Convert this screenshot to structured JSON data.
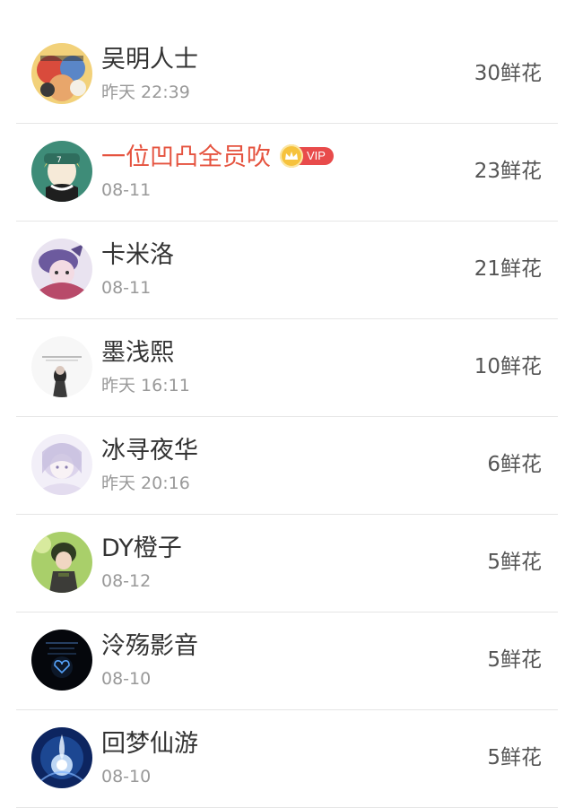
{
  "rows": [
    {
      "name": "吴明人士",
      "time": "昨天 22:39",
      "flowers": "30鲜花",
      "vip": false
    },
    {
      "name": "一位凹凸全员吹",
      "time": "08-11",
      "flowers": "23鲜花",
      "vip": true,
      "vip_label": "VIP"
    },
    {
      "name": "卡米洛",
      "time": "08-11",
      "flowers": "21鲜花",
      "vip": false
    },
    {
      "name": "墨浅熙",
      "time": "昨天 16:11",
      "flowers": "10鲜花",
      "vip": false
    },
    {
      "name": "冰寻夜华",
      "time": "昨天 20:16",
      "flowers": "6鲜花",
      "vip": false
    },
    {
      "name": "DY橙子",
      "time": "08-12",
      "flowers": "5鲜花",
      "vip": false
    },
    {
      "name": "泠殇影音",
      "time": "08-10",
      "flowers": "5鲜花",
      "vip": false
    },
    {
      "name": "回梦仙游",
      "time": "08-10",
      "flowers": "5鲜花",
      "vip": false
    }
  ],
  "colors": {
    "vip_name": "#e5533f",
    "vip_badge": "#e84b4b",
    "crown": "#f6c23d"
  }
}
